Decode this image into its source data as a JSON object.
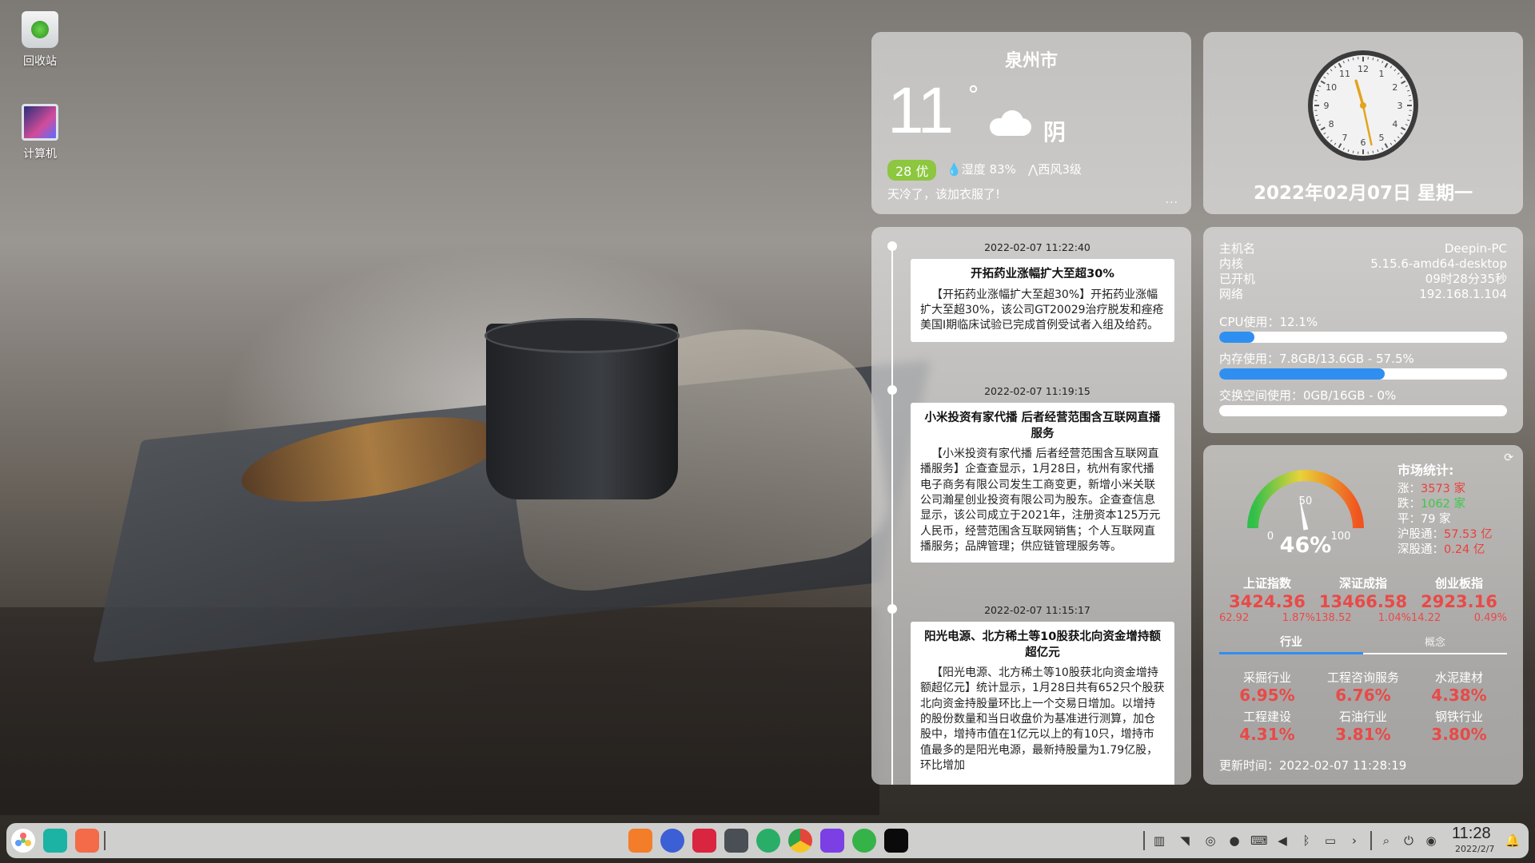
{
  "desktop": {
    "icons": [
      {
        "label": "回收站",
        "icon": "trash-icon"
      },
      {
        "label": "计算机",
        "icon": "computer-icon"
      }
    ]
  },
  "weather": {
    "city": "泉州市",
    "temperature": "11",
    "degree": "°",
    "condition": "阴",
    "aqi": "28 优",
    "humidity": "湿度 83%",
    "wind": "西风3级",
    "tip": "天冷了，该加衣服了!",
    "more": "···"
  },
  "clock": {
    "date": "2022年02月07日 星期一",
    "time_hours": 11,
    "time_minutes": 28,
    "numerals": [
      "12",
      "1",
      "2",
      "3",
      "4",
      "5",
      "6",
      "7",
      "8",
      "9",
      "10",
      "11"
    ]
  },
  "news": [
    {
      "time": "2022-02-07 11:22:40",
      "title": "开拓药业涨幅扩大至超30%",
      "body": "【开拓药业涨幅扩大至超30%】开拓药业涨幅扩大至超30%，该公司GT20029治疗脱发和痤疮美国I期临床试验已完成首例受试者入组及给药。"
    },
    {
      "time": "2022-02-07 11:19:15",
      "title": "小米投资有家代播 后者经营范围含互联网直播服务",
      "body": "【小米投资有家代播 后者经营范围含互联网直播服务】企查查显示，1月28日，杭州有家代播电子商务有限公司发生工商变更，新增小米关联公司瀚星创业投资有限公司为股东。企查查信息显示，该公司成立于2021年，注册资本125万元人民币，经营范围含互联网销售；个人互联网直播服务；品牌管理；供应链管理服务等。"
    },
    {
      "time": "2022-02-07 11:15:17",
      "title": "阳光电源、北方稀土等10股获北向资金增持额超亿元",
      "body": "【阳光电源、北方稀土等10股获北向资金增持额超亿元】统计显示，1月28日共有652只个股获北向资金持股量环比上一个交易日增加。以增持的股份数量和当日收盘价为基准进行测算，加仓股中，增持市值在1亿元以上的有10只，增持市值最多的是阳光电源，最新持股量为1.79亿股，环比增加"
    }
  ],
  "system": {
    "rows": [
      {
        "label": "主机名",
        "value": "Deepin-PC"
      },
      {
        "label": "内核",
        "value": "5.15.6-amd64-desktop"
      },
      {
        "label": "已开机",
        "value": "09时28分35秒"
      },
      {
        "label": "网络",
        "value": "192.168.1.104"
      }
    ],
    "cpu_label": "CPU使用：12.1%",
    "cpu_fraction": 0.121,
    "mem_label": "内存使用：7.8GB/13.6GB - 57.5%",
    "mem_fraction": 0.575,
    "swap_label": "交换空间使用：0GB/16GB - 0%",
    "swap_fraction": 0.0
  },
  "market": {
    "title": "市场统计:",
    "gauge_value": 46,
    "gauge_label": "46%",
    "gauge_ticks": [
      "0",
      "50",
      "100"
    ],
    "stats": [
      {
        "label": "涨：",
        "value": "3573 家",
        "tone": "red"
      },
      {
        "label": "跌：",
        "value": "1062 家",
        "tone": "green"
      },
      {
        "label": "平：",
        "value": "79 家",
        "tone": "white"
      },
      {
        "label": "沪股通：",
        "value": "57.53 亿",
        "tone": "red"
      },
      {
        "label": "深股通：",
        "value": "0.24 亿",
        "tone": "red"
      }
    ],
    "indices": [
      {
        "name": "上证指数",
        "value": "3424.36",
        "change": "62.92",
        "percent": "1.87%"
      },
      {
        "name": "深证成指",
        "value": "13466.58",
        "change": "138.52",
        "percent": "1.04%"
      },
      {
        "name": "创业板指",
        "value": "2923.16",
        "change": "14.22",
        "percent": "0.49%"
      }
    ],
    "tabs": [
      "行业",
      "概念"
    ],
    "industries": [
      {
        "name": "采掘行业",
        "value": "6.95%"
      },
      {
        "name": "工程咨询服务",
        "value": "6.76%"
      },
      {
        "name": "水泥建材",
        "value": "4.38%"
      },
      {
        "name": "工程建设",
        "value": "4.31%"
      },
      {
        "name": "石油行业",
        "value": "3.81%"
      },
      {
        "name": "钢铁行业",
        "value": "3.80%"
      }
    ],
    "update_time": "更新时间：2022-02-07 11:28:19"
  },
  "taskbar": {
    "time": "11:28",
    "date": "2022/2/7",
    "left_apps": [
      "launcher-icon",
      "multitask-view-icon",
      "workspace-icon"
    ],
    "apps": [
      {
        "icon": "app-store-icon",
        "color": "#f47d2a"
      },
      {
        "icon": "settings-icon",
        "color": "#3c5fd6"
      },
      {
        "icon": "terminal-icon",
        "color": "#d9253f"
      },
      {
        "icon": "screen-recorder-icon",
        "color": "#4a4f55"
      },
      {
        "icon": "wechat-icon",
        "color": "#2aae67"
      },
      {
        "icon": "chrome-icon",
        "color": "#e4463a"
      },
      {
        "icon": "intellij-idea-icon",
        "color": "#7b3fe4"
      },
      {
        "icon": "weixin-work-icon",
        "color": "#35b348"
      },
      {
        "icon": "webstorm-icon",
        "color": "#0a0a0a"
      }
    ],
    "tray": [
      "file-manager-icon",
      "wifi-icon",
      "network-icon",
      "wechat-tray-icon",
      "keyboard-icon",
      "volume-icon",
      "bluetooth-icon",
      "battery-icon",
      "expand-icon",
      "search-icon",
      "power-icon",
      "assistant-icon"
    ]
  }
}
